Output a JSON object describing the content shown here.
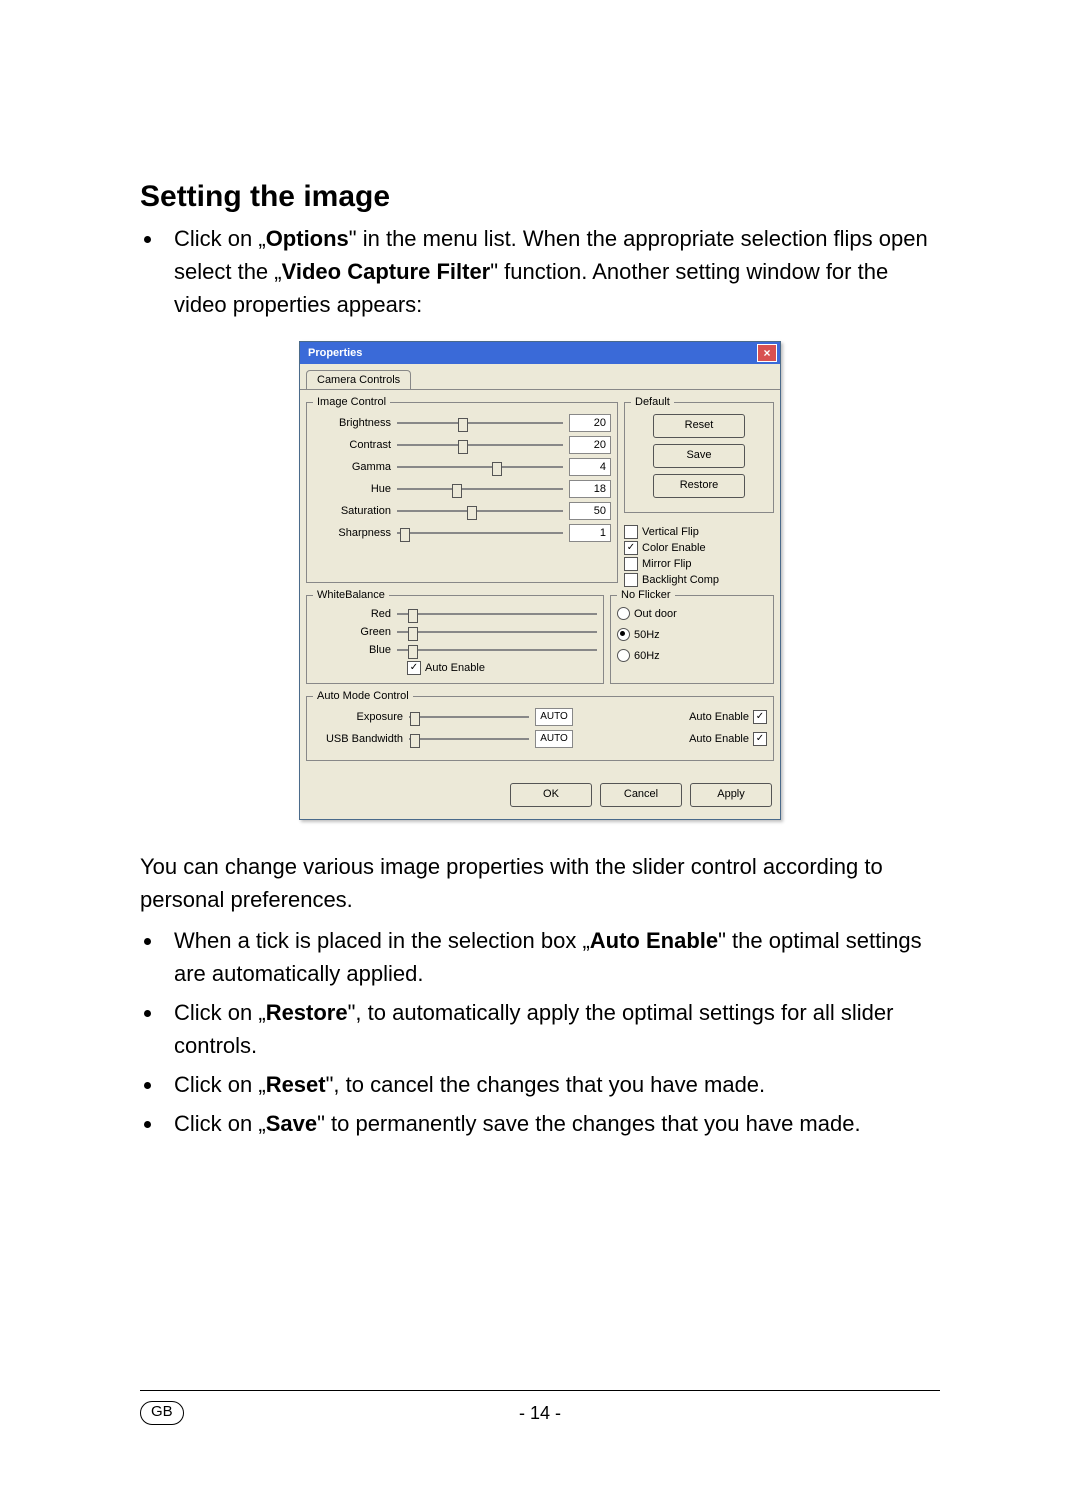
{
  "heading": "Setting the image",
  "intro_bullet": {
    "pre": "Click on „",
    "b1": "Options",
    "mid1": "\" in the menu list. When the appropriate selection flips open select the „",
    "b2": "Video Capture Filter",
    "post": "\" function. Another setting window for the video properties appears:"
  },
  "dialog": {
    "title": "Properties",
    "close": "×",
    "tab": "Camera Controls",
    "groups": {
      "image_control": "Image Control",
      "default": "Default",
      "white_balance": "WhiteBalance",
      "no_flicker": "No Flicker",
      "auto_mode": "Auto Mode Control"
    },
    "buttons": {
      "reset": "Reset",
      "save": "Save",
      "restore": "Restore"
    },
    "checkboxes": {
      "vertical_flip": {
        "label": "Vertical Flip",
        "checked": false
      },
      "color_enable": {
        "label": "Color Enable",
        "checked": true
      },
      "mirror_flip": {
        "label": "Mirror Flip",
        "checked": false
      },
      "backlight": {
        "label": "Backlight Comp",
        "checked": false
      }
    },
    "radios": {
      "outdoor": {
        "label": "Out door",
        "checked": false
      },
      "hz50": {
        "label": "50Hz",
        "checked": true
      },
      "hz60": {
        "label": "60Hz",
        "checked": false
      }
    },
    "sliders": {
      "brightness": {
        "label": "Brightness",
        "value": "20",
        "pct": 40
      },
      "contrast": {
        "label": "Contrast",
        "value": "20",
        "pct": 40
      },
      "gamma": {
        "label": "Gamma",
        "value": "4",
        "pct": 60
      },
      "hue": {
        "label": "Hue",
        "value": "18",
        "pct": 36
      },
      "saturation": {
        "label": "Saturation",
        "value": "50",
        "pct": 45
      },
      "sharpness": {
        "label": "Sharpness",
        "value": "1",
        "pct": 5
      }
    },
    "wb": {
      "red": {
        "label": "Red",
        "pct": 8
      },
      "green": {
        "label": "Green",
        "pct": 8
      },
      "blue": {
        "label": "Blue",
        "pct": 8
      },
      "auto_enable": {
        "label": "Auto Enable",
        "checked": true
      }
    },
    "auto_mode": {
      "exposure": {
        "label": "Exposure",
        "text": "AUTO",
        "pct": 5,
        "ae_label": "Auto Enable",
        "checked": true
      },
      "bandwidth": {
        "label": "USB Bandwidth",
        "text": "AUTO",
        "pct": 5,
        "ae_label": "Auto Enable",
        "checked": true
      }
    },
    "footer": {
      "ok": "OK",
      "cancel": "Cancel",
      "apply": "Apply"
    }
  },
  "para2": "You can change various image properties with the slider control according to personal preferences.",
  "bullets2": [
    {
      "pre": "When a tick is placed in the selection box „",
      "b": "Auto Enable",
      "post": "\" the optimal settings are automatically applied."
    },
    {
      "pre": "Click on „",
      "b": "Restore",
      "post": "\", to automatically apply the optimal settings for all slider controls."
    },
    {
      "pre": "Click on „",
      "b": "Reset",
      "post": "\", to cancel the changes that you have made."
    },
    {
      "pre": "Click on „",
      "b": "Save",
      "post": "\" to permanently save the changes that you have made."
    }
  ],
  "footer": {
    "gb": "GB",
    "page": "- 14 -"
  }
}
